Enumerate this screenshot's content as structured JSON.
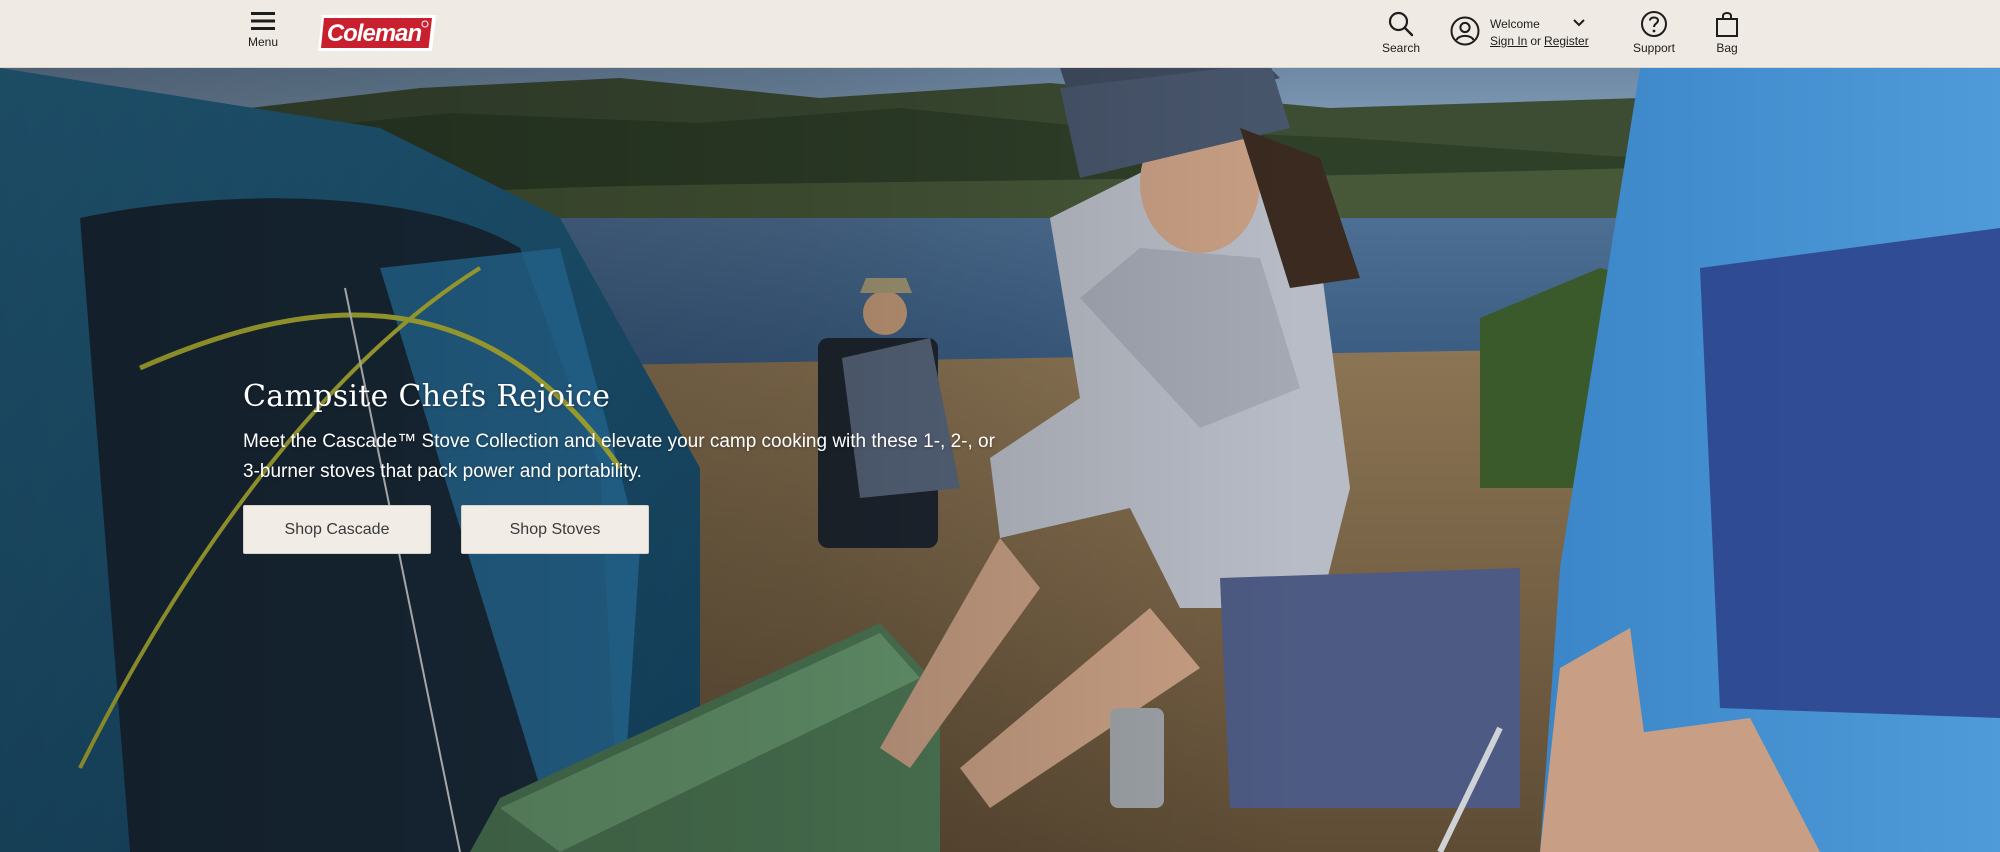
{
  "header": {
    "menu_label": "Menu",
    "brand": "Coleman",
    "search_label": "Search",
    "welcome": "Welcome",
    "sign_in": "Sign In",
    "or": "or",
    "register": "Register",
    "support_label": "Support",
    "bag_label": "Bag"
  },
  "hero": {
    "title": "Campsite Chefs Rejoice",
    "description": "Meet the Cascade™ Stove Collection and elevate your camp cooking with these 1-, 2-, or 3-burner stoves that pack power and portability.",
    "buttons": [
      "Shop Cascade",
      "Shop Stoves"
    ]
  },
  "colors": {
    "header_bg": "#efebe4",
    "brand_red": "#c8202f",
    "button_bg": "#f1ede6",
    "text_dark": "#1d1d1d"
  },
  "icons": [
    "hamburger-menu-icon",
    "search-icon",
    "user-account-icon",
    "chevron-down-icon",
    "help-circle-icon",
    "shopping-bag-icon"
  ]
}
